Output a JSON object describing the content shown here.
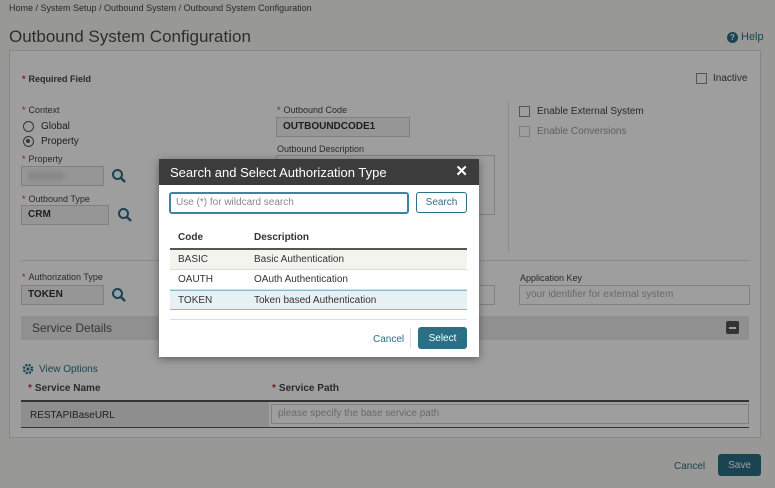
{
  "breadcrumb": "Home / System Setup / Outbound System / Outbound System Configuration",
  "page_title": "Outbound System Configuration",
  "help_label": "Help",
  "required_field": "Required Field",
  "inactive_label": "Inactive",
  "context": {
    "label": "Context",
    "options": [
      "Global",
      "Property"
    ],
    "selected": "Property"
  },
  "property": {
    "label": "Property",
    "value": ""
  },
  "outbound_type": {
    "label": "Outbound Type",
    "value": "CRM"
  },
  "outbound_code": {
    "label": "Outbound Code",
    "value": "OUTBOUNDCODE1"
  },
  "outbound_description": {
    "label": "Outbound Description"
  },
  "enable_external": "Enable External System",
  "enable_conversions": "Enable Conversions",
  "authorization_type": {
    "label": "Authorization Type",
    "value": "TOKEN"
  },
  "application_key": {
    "label": "Application Key",
    "placeholder": "your identifier for external system"
  },
  "service_details": "Service Details",
  "view_options": "View Options",
  "service_table": {
    "col1": "Service Name",
    "col2": "Service Path",
    "row_name": "RESTAPIBaseURL",
    "row_path_placeholder": "please specify the base service path"
  },
  "footer": {
    "cancel": "Cancel",
    "save": "Save"
  },
  "dialog": {
    "title": "Search and Select Authorization Type",
    "search_placeholder": "Use (*) for wildcard search",
    "search_button": "Search",
    "headers": [
      "Code",
      "Description"
    ],
    "rows": [
      [
        "BASIC",
        "Basic Authentication"
      ],
      [
        "OAUTH",
        "OAuth Authentication"
      ],
      [
        "TOKEN",
        "Token based Authentication"
      ]
    ],
    "selected_row": "TOKEN",
    "cancel": "Cancel",
    "select": "Select"
  },
  "colors": {
    "accent": "#2a6f85",
    "required": "#c0392b",
    "dialog_header": "#3c3c3c"
  }
}
